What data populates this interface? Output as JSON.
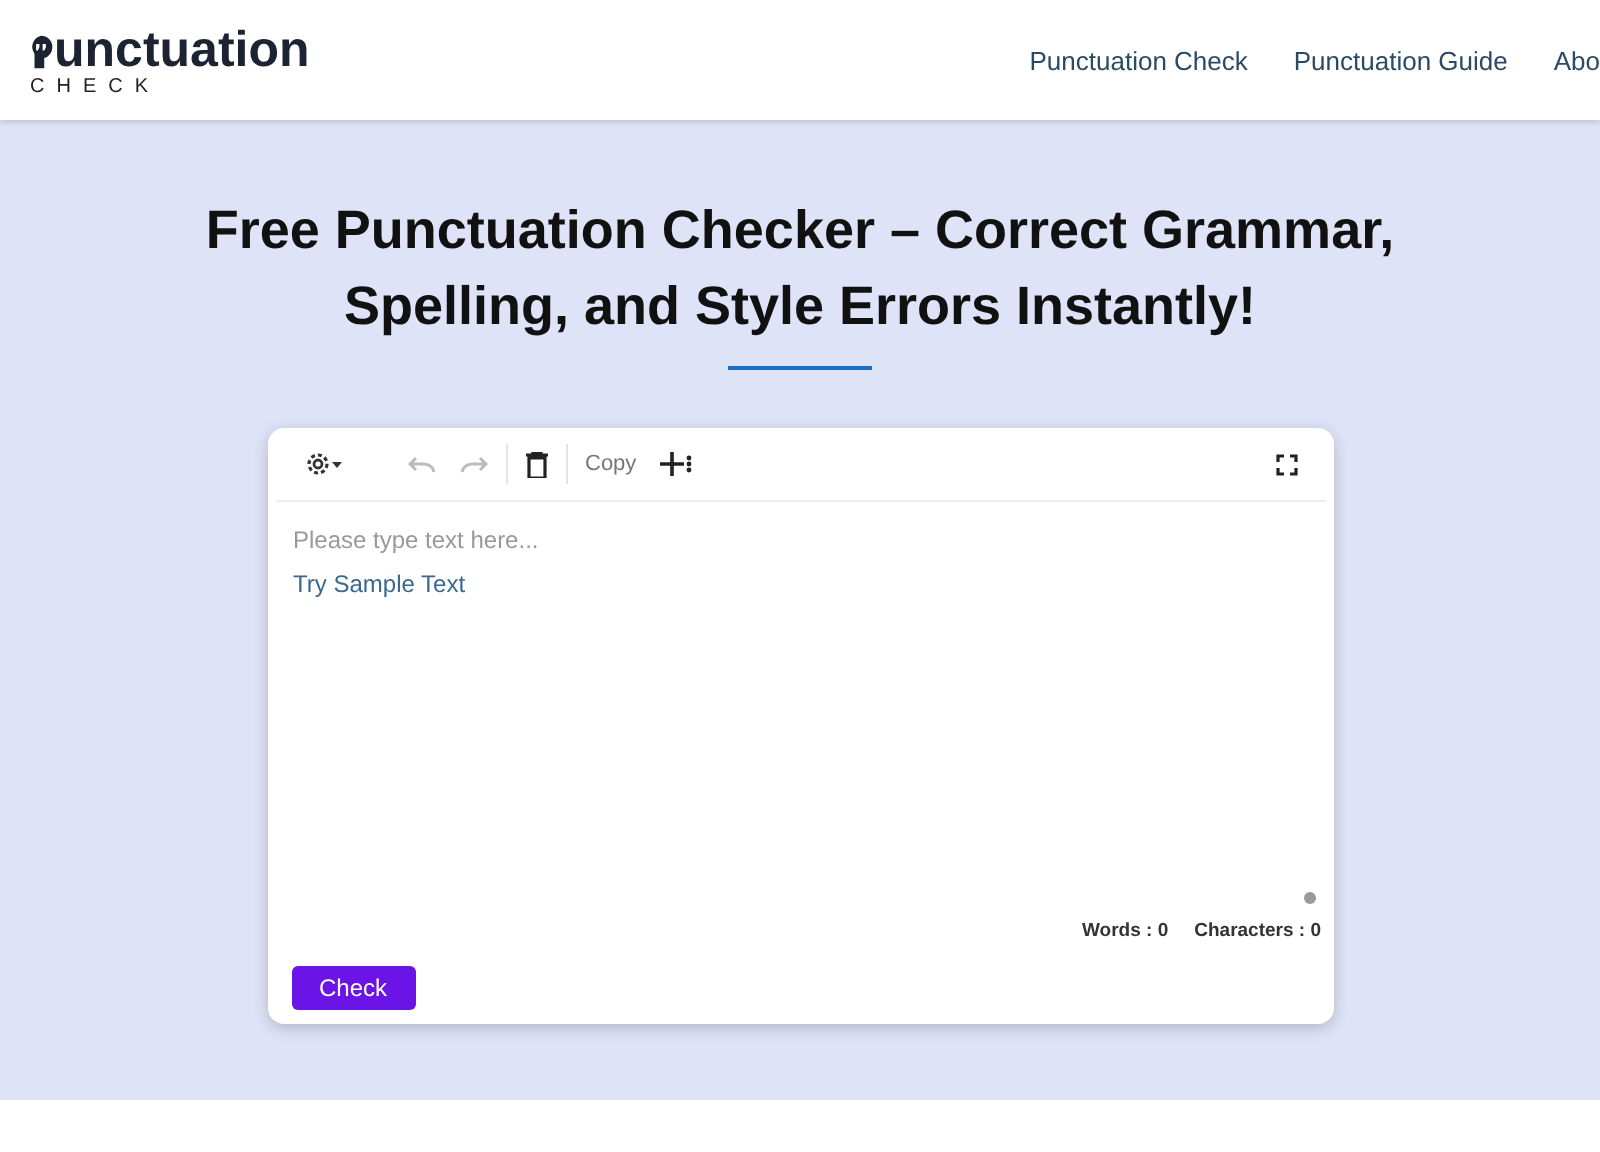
{
  "logo": {
    "text": "unctuation",
    "subtitle": "CHECK"
  },
  "nav": [
    {
      "label": "Punctuation Check"
    },
    {
      "label": "Punctuation Guide"
    },
    {
      "label": "Abo"
    }
  ],
  "hero": {
    "title": "Free Punctuation Checker – Correct Grammar, Spelling, and Style Errors Instantly!"
  },
  "toolbar": {
    "undo": {
      "disabled": true
    },
    "redo": {
      "disabled": true
    },
    "copy": "Copy"
  },
  "editor": {
    "placeholder": "Please type text here...",
    "sample_link": "Try Sample Text"
  },
  "stats": [
    {
      "label": "Words : 0"
    },
    {
      "label": "Characters : 0"
    }
  ],
  "check_button": "Check"
}
